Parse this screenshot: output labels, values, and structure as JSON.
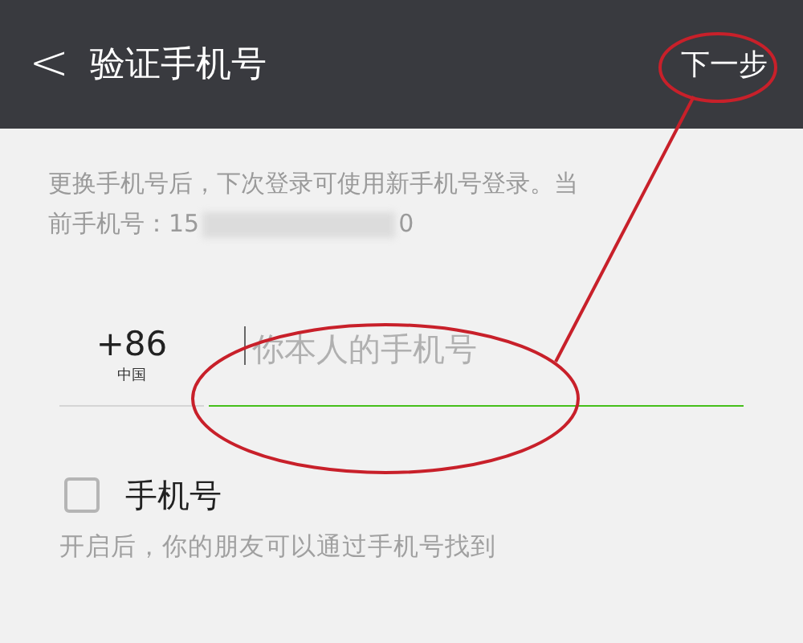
{
  "header": {
    "back_icon": "<",
    "title": "验证手机号",
    "next_button": "下一步"
  },
  "description": {
    "line_1": "更换手机号后，下次登录可使用新手机号登录。当",
    "line_2": "前手机号：15",
    "text_after_blur": "0"
  },
  "phone": {
    "country_code": "+86",
    "country": "中国",
    "placeholder": "你本人的手机号",
    "focused": true
  },
  "option": {
    "label": "手机号",
    "checked": false,
    "hint": "开启后，你的朋友可以通过手机号找到"
  }
}
